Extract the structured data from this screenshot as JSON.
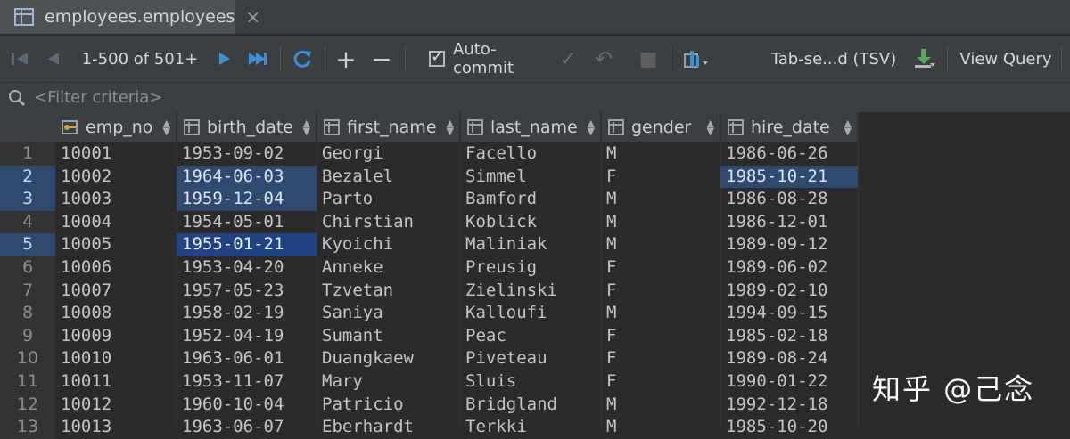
{
  "tab": {
    "title": "employees.employees",
    "close": "×"
  },
  "toolbar": {
    "first": "⏮",
    "prev": "◀",
    "page_info": "1-500 of 501+",
    "next": "▶",
    "last": "⏭",
    "refresh": "⟳",
    "add": "+",
    "remove": "−",
    "autocommit_check": "✓",
    "autocommit_label": "Auto-commit",
    "autocommit_arrow": "✓",
    "revert": "↶",
    "stop": "■",
    "export_format": "Tab-se...d (TSV)",
    "view_query": "View Query"
  },
  "filter": {
    "placeholder": "<Filter criteria>"
  },
  "columns": [
    {
      "label": "emp_no"
    },
    {
      "label": "birth_date"
    },
    {
      "label": "first_name"
    },
    {
      "label": "last_name"
    },
    {
      "label": "gender"
    },
    {
      "label": "hire_date"
    }
  ],
  "rows": [
    {
      "n": "1",
      "emp_no": "10001",
      "birth_date": "1953-09-02",
      "first_name": "Georgi",
      "last_name": "Facello",
      "gender": "M",
      "hire_date": "1986-06-26"
    },
    {
      "n": "2",
      "emp_no": "10002",
      "birth_date": "1964-06-03",
      "first_name": "Bezalel",
      "last_name": "Simmel",
      "gender": "F",
      "hire_date": "1985-10-21"
    },
    {
      "n": "3",
      "emp_no": "10003",
      "birth_date": "1959-12-04",
      "first_name": "Parto",
      "last_name": "Bamford",
      "gender": "M",
      "hire_date": "1986-08-28"
    },
    {
      "n": "4",
      "emp_no": "10004",
      "birth_date": "1954-05-01",
      "first_name": "Chirstian",
      "last_name": "Koblick",
      "gender": "M",
      "hire_date": "1986-12-01"
    },
    {
      "n": "5",
      "emp_no": "10005",
      "birth_date": "1955-01-21",
      "first_name": "Kyoichi",
      "last_name": "Maliniak",
      "gender": "M",
      "hire_date": "1989-09-12"
    },
    {
      "n": "6",
      "emp_no": "10006",
      "birth_date": "1953-04-20",
      "first_name": "Anneke",
      "last_name": "Preusig",
      "gender": "F",
      "hire_date": "1989-06-02"
    },
    {
      "n": "7",
      "emp_no": "10007",
      "birth_date": "1957-05-23",
      "first_name": "Tzvetan",
      "last_name": "Zielinski",
      "gender": "F",
      "hire_date": "1989-02-10"
    },
    {
      "n": "8",
      "emp_no": "10008",
      "birth_date": "1958-02-19",
      "first_name": "Saniya",
      "last_name": "Kalloufi",
      "gender": "M",
      "hire_date": "1994-09-15"
    },
    {
      "n": "9",
      "emp_no": "10009",
      "birth_date": "1952-04-19",
      "first_name": "Sumant",
      "last_name": "Peac",
      "gender": "F",
      "hire_date": "1985-02-18"
    },
    {
      "n": "10",
      "emp_no": "10010",
      "birth_date": "1963-06-01",
      "first_name": "Duangkaew",
      "last_name": "Piveteau",
      "gender": "F",
      "hire_date": "1989-08-24"
    },
    {
      "n": "11",
      "emp_no": "10011",
      "birth_date": "1953-11-07",
      "first_name": "Mary",
      "last_name": "Sluis",
      "gender": "F",
      "hire_date": "1990-01-22"
    },
    {
      "n": "12",
      "emp_no": "10012",
      "birth_date": "1960-10-04",
      "first_name": "Patricio",
      "last_name": "Bridgland",
      "gender": "M",
      "hire_date": "1992-12-18"
    },
    {
      "n": "13",
      "emp_no": "10013",
      "birth_date": "1963-06-07",
      "first_name": "Eberhardt",
      "last_name": "Terkki",
      "gender": "M",
      "hire_date": "1985-10-20"
    }
  ],
  "watermark": "知乎 @己念",
  "colors": {
    "background": "#2b2b2b",
    "selection": "#2f4a6e",
    "selection_strong": "#214283",
    "icon_blue": "#3d8fd6"
  }
}
